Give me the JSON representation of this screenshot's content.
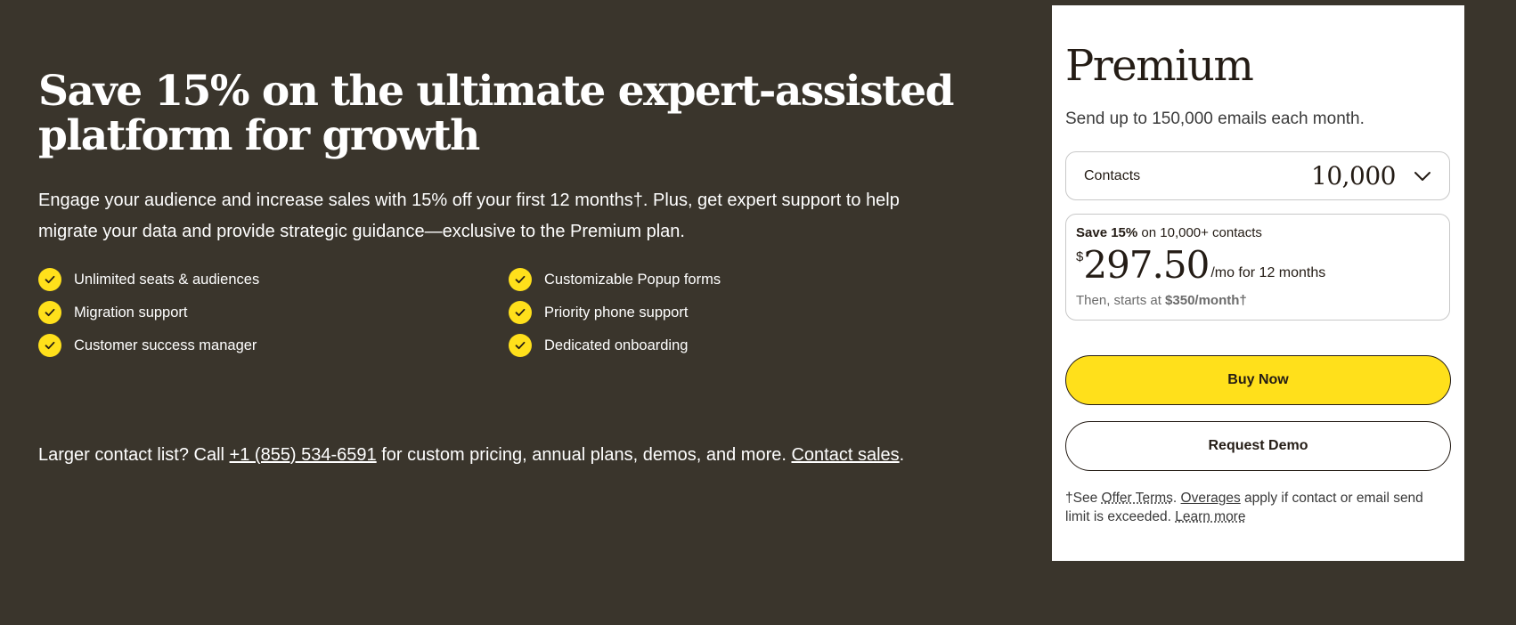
{
  "hero": {
    "headline_line1": "Save 15% on the ultimate expert-assisted",
    "headline_line2": "platform for growth",
    "subtext_line1": "Engage your audience and increase sales with 15% off your first 12 months†. Plus, get expert support to help",
    "subtext_line2": "migrate your data and provide strategic guidance—exclusive to the Premium plan."
  },
  "features": [
    "Unlimited seats & audiences",
    "Customizable Popup forms",
    "Migration support",
    "Priority phone support",
    "Customer success manager",
    "Dedicated onboarding"
  ],
  "contact_line": {
    "prefix": "Larger contact list? Call ",
    "phone": "+1 (855) 534-6591",
    "middle": " for custom pricing, annual plans, demos, and more. ",
    "link": "Contact sales",
    "suffix": "."
  },
  "card": {
    "title": "Premium",
    "description": "Send up to 150,000 emails each month.",
    "contacts_label": "Contacts",
    "contacts_value": "10,000",
    "offer": {
      "save_bold": "Save 15%",
      "save_rest": " on 10,000+ contacts",
      "currency": "$",
      "price": "297.50",
      "per": "/mo for 12 months",
      "then_prefix": "Then, starts at ",
      "then_bold": "$350/month†"
    },
    "buy_label": "Buy Now",
    "demo_label": "Request Demo",
    "footnote": {
      "p1": "†See ",
      "offer_terms": "Offer Terms",
      "p2": ". ",
      "overages": "Overages",
      "p3": " apply if contact or email send limit is exceeded. ",
      "learn_more": "Learn more"
    }
  },
  "colors": {
    "background": "#3a352c",
    "accent": "#ffe01b",
    "card": "#ffffff",
    "text_dark": "#241c15"
  },
  "icons": {
    "feature_check": "check-icon",
    "dropdown": "chevron-down-icon"
  }
}
